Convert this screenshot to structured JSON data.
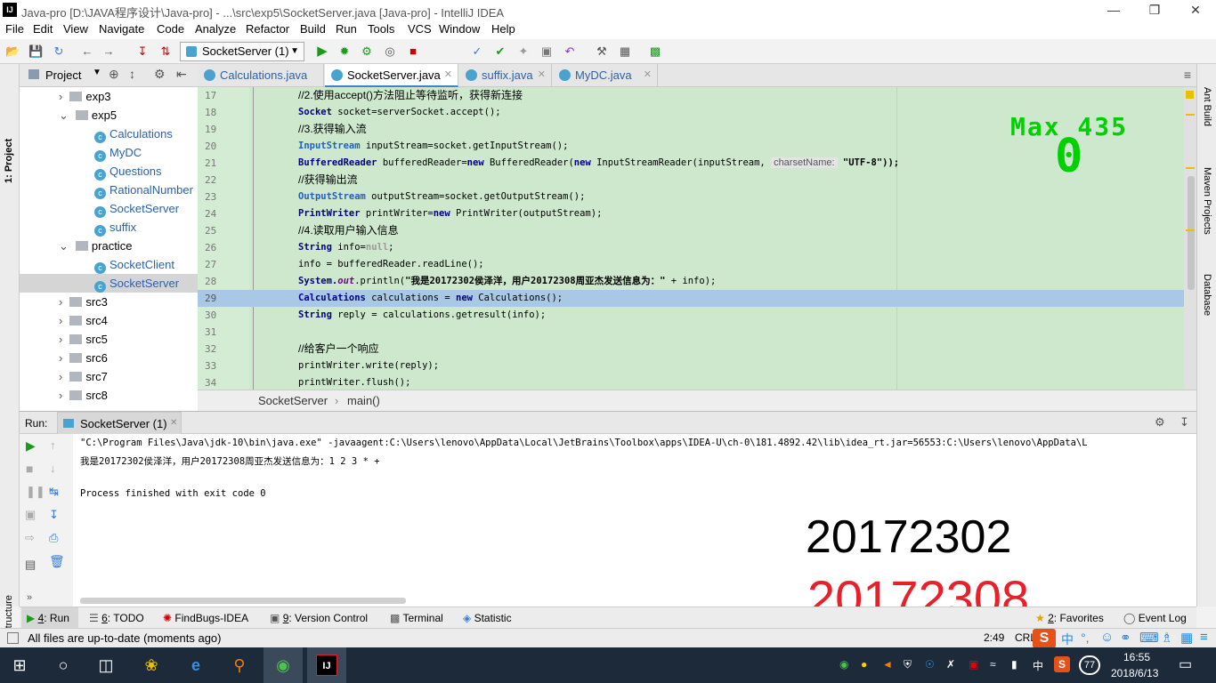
{
  "window": {
    "title": "Java-pro [D:\\JAVA程序设计\\Java-pro] - ...\\src\\exp5\\SocketServer.java [Java-pro] - IntelliJ IDEA",
    "logo_text": "IJ"
  },
  "menu": [
    "File",
    "Edit",
    "View",
    "Navigate",
    "Code",
    "Analyze",
    "Refactor",
    "Build",
    "Run",
    "Tools",
    "VCS",
    "Window",
    "Help"
  ],
  "toolbar": {
    "run_config": "SocketServer (1)"
  },
  "left_strip": {
    "project": "1: Project",
    "structure": "7: Structure"
  },
  "right_strip": {
    "ant": "Ant Build",
    "maven": "Maven Projects",
    "database": "Database"
  },
  "project_panel": {
    "title": "Project"
  },
  "tree": [
    {
      "label": "exp3",
      "kind": "folder",
      "expanded": false
    },
    {
      "label": "exp5",
      "kind": "folder",
      "expanded": true
    },
    {
      "label": "Calculations",
      "kind": "class"
    },
    {
      "label": "MyDC",
      "kind": "class"
    },
    {
      "label": "Questions",
      "kind": "class"
    },
    {
      "label": "RationalNumber",
      "kind": "class"
    },
    {
      "label": "SocketServer",
      "kind": "class"
    },
    {
      "label": "suffix",
      "kind": "class"
    },
    {
      "label": "practice",
      "kind": "folder",
      "expanded": true
    },
    {
      "label": "SocketClient",
      "kind": "class"
    },
    {
      "label": "SocketServer",
      "kind": "class",
      "selected": true
    },
    {
      "label": "src3",
      "kind": "folder"
    },
    {
      "label": "src4",
      "kind": "folder"
    },
    {
      "label": "src5",
      "kind": "folder"
    },
    {
      "label": "src6",
      "kind": "folder"
    },
    {
      "label": "src7",
      "kind": "folder"
    },
    {
      "label": "src8",
      "kind": "folder"
    }
  ],
  "editor_tabs": [
    {
      "label": "Calculations.java",
      "active": false
    },
    {
      "label": "SocketServer.java",
      "active": true
    },
    {
      "label": "suffix.java",
      "active": false
    },
    {
      "label": "MyDC.java",
      "active": false
    }
  ],
  "code_lines": {
    "l17": {
      "no": "17",
      "text": "//2.使用accept()方法阻止等待监听，获得新连接"
    },
    "l18": {
      "no": "18",
      "a": "Socket",
      "b": " socket=serverSocket.accept();"
    },
    "l19": {
      "no": "19",
      "text": "//3.获得输入流"
    },
    "l20": {
      "no": "20",
      "a": "InputStream",
      "b": " inputStream=socket.getInputStream();"
    },
    "l21": {
      "no": "21",
      "a": "BufferedReader",
      "b": " bufferedReader=",
      "c": "new",
      "d": " BufferedReader(",
      "e": "new",
      "f": " InputStreamReader(inputStream, ",
      "hint": "charsetName:",
      "g": " \"UTF-8\"));"
    },
    "l22": {
      "no": "22",
      "text": "//获得输出流"
    },
    "l23": {
      "no": "23",
      "a": "OutputStream",
      "b": " outputStream=socket.getOutputStream();"
    },
    "l24": {
      "no": "24",
      "a": "PrintWriter",
      "b": " printWriter=",
      "c": "new",
      "d": " PrintWriter(outputStream);"
    },
    "l25": {
      "no": "25",
      "text": "//4.读取用户输入信息"
    },
    "l26": {
      "no": "26",
      "a": "String",
      "b": " info=",
      "c": "null",
      "d": ";"
    },
    "l27": {
      "no": "27",
      "b": "info = bufferedReader.readLine();"
    },
    "l28": {
      "no": "28",
      "a": "System.",
      "o": "out",
      "b": ".println(",
      "s": "\"我是20172302侯泽洋，用户20172308周亚杰发送信息为：\"",
      "d": " + info);"
    },
    "l29": {
      "no": "29",
      "a": "Calculations",
      "b": " calculations = ",
      "c": "new",
      "d": " Calculations();"
    },
    "l30": {
      "no": "30",
      "a": "String",
      "b": " reply = calculations.getresult(info);"
    },
    "l31": {
      "no": "31"
    },
    "l32": {
      "no": "32",
      "text": "//给客户一个响应"
    },
    "l33": {
      "no": "33",
      "b": "printWriter.write(reply);"
    },
    "l34": {
      "no": "34",
      "b": "printWriter.flush();"
    }
  },
  "breadcrumb": {
    "class": "SocketServer",
    "sep": "›",
    "method": "main()"
  },
  "run_panel": {
    "label": "Run:",
    "tab": "SocketServer (1)"
  },
  "console": {
    "line1": "\"C:\\Program Files\\Java\\jdk-10\\bin\\java.exe\" -javaagent:C:\\Users\\lenovo\\AppData\\Local\\JetBrains\\Toolbox\\apps\\IDEA-U\\ch-0\\181.4892.42\\lib\\idea_rt.jar=56553:C:\\Users\\lenovo\\AppData\\L",
    "line2": "我是20172302侯泽洋，用户20172308周亚杰发送信息为：1 2 3 * +",
    "line3": "Process finished with exit code 0"
  },
  "overlay": {
    "max_label": "Max 435",
    "zero": "0",
    "num1": "20172302",
    "num2": "20172308",
    "num2_color": "#e8202a",
    "green": "#00d000"
  },
  "bottom_tabs": [
    {
      "key": "4",
      "label": ": Run"
    },
    {
      "key": "6",
      "label": ": TODO"
    },
    {
      "key": "",
      "label": "FindBugs-IDEA"
    },
    {
      "key": "9",
      "label": ": Version Control"
    },
    {
      "key": "",
      "label": "Terminal"
    },
    {
      "key": "",
      "label": "Statistic"
    }
  ],
  "bottom_right": {
    "favorites_key": "2",
    "favorites": ": Favorites",
    "event_log": "Event Log"
  },
  "status": {
    "message": "All files are up-to-date (moments ago)",
    "position": "2:49",
    "line_sep": "CRL"
  },
  "taskbar": {
    "time": "16:55",
    "date": "2018/6/13",
    "lang": "中",
    "badge": "77"
  }
}
